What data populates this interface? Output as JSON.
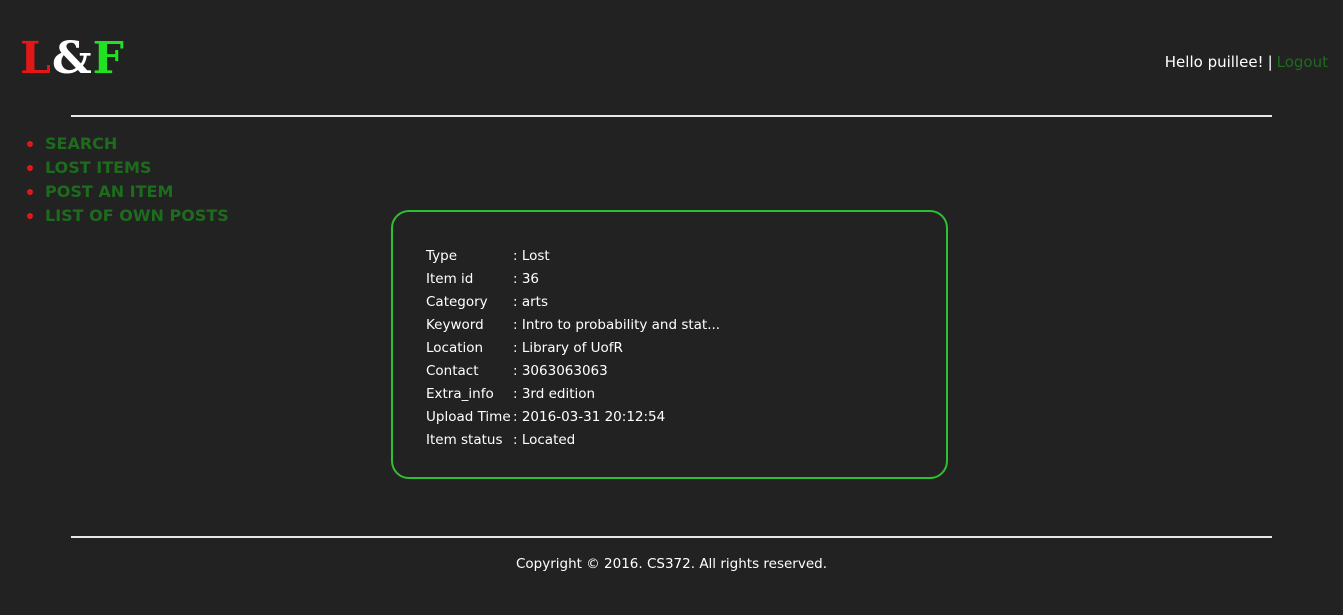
{
  "header": {
    "logo": {
      "l": "L",
      "amp": "&",
      "f": "F"
    },
    "greeting": "Hello puillee!",
    "separator": "|",
    "logout_label": "Logout"
  },
  "nav": {
    "items": [
      {
        "label": "SEARCH"
      },
      {
        "label": "LOST ITEMS"
      },
      {
        "label": "POST AN ITEM"
      },
      {
        "label": "LIST OF OWN POSTS"
      }
    ]
  },
  "item_details": {
    "rows": [
      {
        "key": "Type",
        "value": ": Lost"
      },
      {
        "key": "Item id",
        "value": ": 36"
      },
      {
        "key": "Category",
        "value": ": arts"
      },
      {
        "key": "Keyword",
        "value": ": Intro to probability and stat..."
      },
      {
        "key": "Location",
        "value": ": Library of UofR"
      },
      {
        "key": "Contact",
        "value": ": 3063063063"
      },
      {
        "key": "Extra_info",
        "value": ": 3rd edition"
      },
      {
        "key": "Upload Time",
        "value": ": 2016-03-31 20:12:54"
      },
      {
        "key": "Item status",
        "value": ": Located"
      }
    ]
  },
  "footer": {
    "copyright": "Copyright © 2016. CS372. All rights reserved."
  },
  "colors": {
    "background": "#222222",
    "link_green": "#1d6b1d",
    "accent_red": "#e01818",
    "accent_green": "#22e022",
    "card_border": "#2ec02e"
  }
}
